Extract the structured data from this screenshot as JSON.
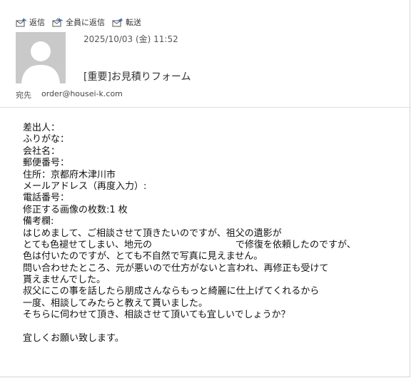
{
  "toolbar": {
    "reply_label": "返信",
    "reply_all_label": "全員に返信",
    "forward_label": "転送"
  },
  "header": {
    "date": "2025/10/03 (金) 11:52",
    "subject": "[重要]お見積りフォーム",
    "to_label": "宛先",
    "to_address": "order@housei-k.com"
  },
  "body": {
    "lines": [
      "差出人：",
      "ふりがな：",
      "会社名：",
      "郵便番号：",
      "住所：京都府木津川市",
      "メールアドレス（再度入力）:",
      "電話番号：",
      "修正する画像の枚数:1 枚",
      "備考欄:",
      "はじめまして、ご相談させて頂きたいのですが、祖父の遺影が",
      "とても色褪せてしまい、地元の　　　　　　　　　で修復を依頼したのですが、",
      "色は付いたのですが、とても不自然で写真に見えません。",
      "問い合わせたところ、元が悪いので仕方がないと言われ、再修正も受けて",
      "貰えませんでした。",
      "叔父にこの事を話したら朋成さんならもっと綺麗に仕上げてくれるから",
      "一度、相談してみたらと教えて貰いました。",
      "そちらに伺わせて頂き、相談させて頂いても宜しいでしょうか？",
      "",
      "宜しくお願い致します。"
    ]
  },
  "colors": {
    "icon_blue": "#3b6fb6",
    "avatar_bg": "#c9c9c9"
  }
}
